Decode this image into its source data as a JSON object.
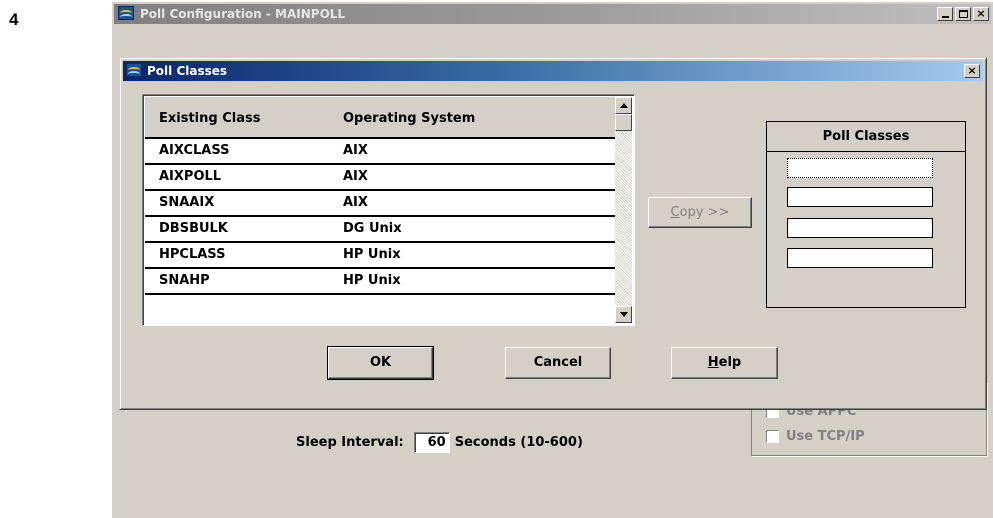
{
  "step_number": "4",
  "outer_window": {
    "title": "Poll Configuration -  MAINPOLL",
    "sleep_interval": {
      "label": "Sleep Interval:",
      "value": "60",
      "suffix": "Seconds (10-600)"
    },
    "protocols": {
      "partial_label": "Use APPC",
      "tcpip_label": "Use TCP/IP"
    }
  },
  "dialog": {
    "title": "Poll Classes",
    "close_label": "×",
    "list": {
      "columns": [
        "Existing Class",
        "Operating System"
      ],
      "rows": [
        {
          "class": "AIXCLASS",
          "os": "AIX"
        },
        {
          "class": "AIXPOLL",
          "os": "AIX"
        },
        {
          "class": "SNAAIX",
          "os": "AIX"
        },
        {
          "class": "DBSBULK",
          "os": "DG Unix"
        },
        {
          "class": "HPCLASS",
          "os": "HP Unix"
        },
        {
          "class": "SNAHP",
          "os": "HP Unix"
        }
      ]
    },
    "copy_button": {
      "underlined": "C",
      "rest": "opy >>"
    },
    "poll_classes_panel": {
      "heading": "Poll Classes",
      "slots": [
        "",
        "",
        "",
        ""
      ]
    },
    "buttons": {
      "ok": "OK",
      "cancel": "Cancel",
      "help_underlined": "H",
      "help_rest": "elp"
    }
  }
}
